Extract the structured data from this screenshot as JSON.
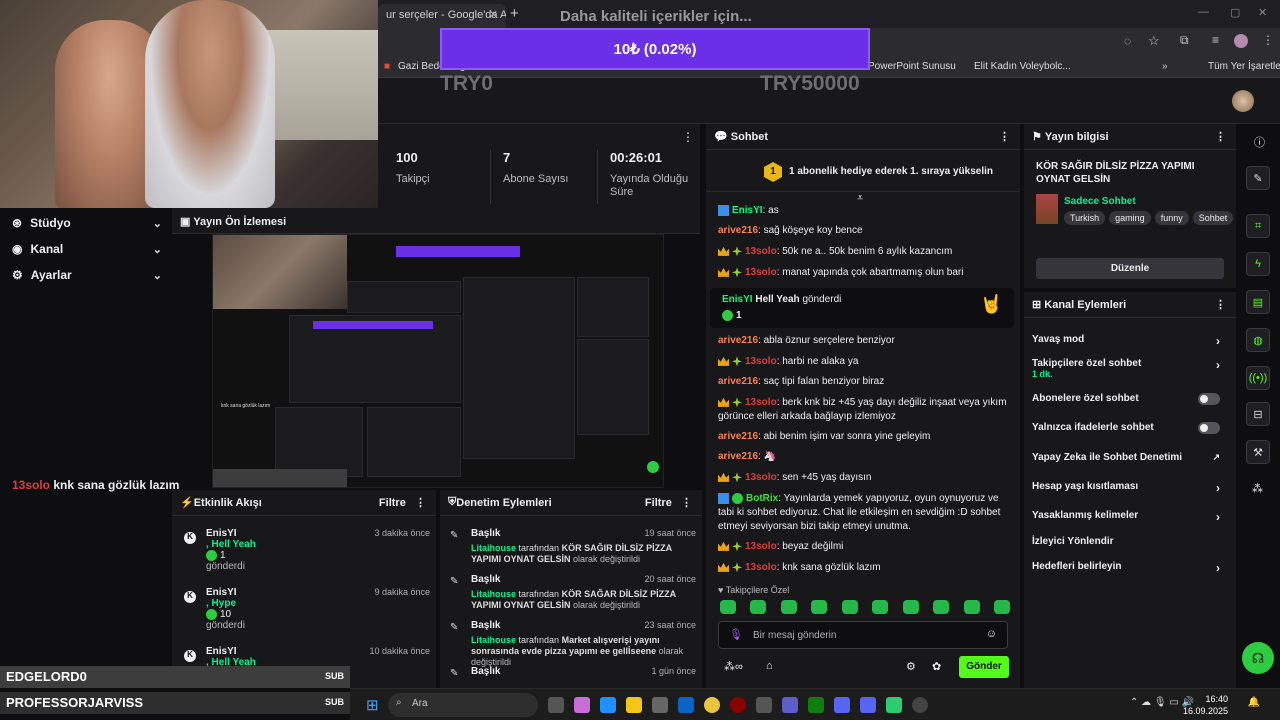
{
  "browser": {
    "tab_title": "ur serçeler - Google'da Ara",
    "bookmarks": [
      "Gazi Beden Eğitimi",
      "PowerPoint Sunusu",
      "Elit Kadın Voleybolc...",
      "Tüm Yer İşaretleri"
    ]
  },
  "donation": {
    "title": "Daha kaliteli içerikler için...",
    "progress_label": "10₺ (0.02%)",
    "progress_fraction": 0.0002,
    "min": "TRY0",
    "max": "TRY50000"
  },
  "stats": {
    "items": [
      {
        "value": "100",
        "label": "Takipçi"
      },
      {
        "value": "7",
        "label": "Abone Sayısı"
      },
      {
        "value": "00:26:01",
        "label": "Yayında Olduğu Süre"
      }
    ]
  },
  "nav": {
    "items": [
      {
        "label": "Stüdyo"
      },
      {
        "label": "Kanal"
      },
      {
        "label": "Ayarlar"
      }
    ]
  },
  "preview": {
    "title": "Yayın Ön İzlemesi",
    "overlay_user": "13solo",
    "overlay_msg": "knk sana gözlük lazım"
  },
  "activity": {
    "title": "Etkinlik Akışı",
    "filter": "Filtre",
    "items": [
      {
        "name": "EnisYI",
        "action": ", Hell Yeah",
        "count": "1",
        "sent": "gönderdi",
        "time": "3 dakika önce"
      },
      {
        "name": "EnisYI",
        "action": ", Hype",
        "count": "10",
        "sent": "gönderdi",
        "time": "9 dakika önce"
      },
      {
        "name": "EnisYI",
        "action": ", Hell Yeah",
        "count": "",
        "sent": "",
        "time": "10 dakika önce"
      }
    ]
  },
  "moderation": {
    "title": "Denetim Eylemleri",
    "filter": "Filtre",
    "items": [
      {
        "title": "Başlık",
        "time": "19 saat önce",
        "user": "Litaihouse",
        "by": "tarafından",
        "value": "KÖR SAĞIR DİLSİZ PİZZA YAPIMI OYNAT GELSİN",
        "suffix": "olarak değiştirildi"
      },
      {
        "title": "Başlık",
        "time": "20 saat önce",
        "user": "Litaihouse",
        "by": "tarafından",
        "value": "KÖR SAĞAR DİLSİZ PİZZA YAPIMI OYNAT GELSİN",
        "suffix": "olarak değiştirildi"
      },
      {
        "title": "Başlık",
        "time": "23 saat önce",
        "user": "Litaihouse",
        "by": "tarafından",
        "value": "Market alışverişi yayını sonrasında evde pizza yapımı ee gellİseene",
        "suffix": "olarak değiştirildi"
      },
      {
        "title": "Başlık",
        "time": "1 gün önce",
        "user": "",
        "by": "",
        "value": "",
        "suffix": ""
      }
    ]
  },
  "chat": {
    "title": "Sohbet",
    "pinned": "1 abonelik hediye ederek 1. sıraya yükselin",
    "pinned_count": "1",
    "messages": [
      {
        "user": "EnisYI",
        "text": "as"
      },
      {
        "user": "arive216",
        "text": "sağ köşeye koy bence"
      },
      {
        "user": "13solo",
        "text": "50k ne a.. 50k benim 6 aylık kazancım"
      },
      {
        "user": "13solo",
        "text": "manat yapında çok abartmamış olun bari"
      },
      {
        "user": "arive216",
        "text": "abla öznur serçelere benziyor"
      },
      {
        "user": "13solo",
        "text": "harbi ne alaka ya"
      },
      {
        "user": "arive216",
        "text": "saç tipi falan benziyor biraz"
      },
      {
        "user": "13solo",
        "text": "berk knk biz +45 yaş dayı değiliz inşaat veya yıkım görünce elleri arkada bağlayıp izlemiyoz"
      },
      {
        "user": "arive216",
        "text": "abi benim işim var sonra yine geleyim"
      },
      {
        "user": "arive216",
        "text": ""
      },
      {
        "user": "13solo",
        "text": "sen +45 yaş dayısın"
      },
      {
        "user": "BotRix",
        "text": "Yayınlarda yemek yapıyoruz, oyun oynuyoruz ve tabi ki sohbet ediyoruz. Chat ile etkileşim en sevdiğim :D sohbet etmeyi seviyorsan bizi takip etmeyi unutma."
      },
      {
        "user": "13solo",
        "text": "beyaz değilmi"
      },
      {
        "user": "13solo",
        "text": "knk sana gözlük lazım"
      }
    ],
    "gift": {
      "user": "EnisYI",
      "item": "Hell Yeah",
      "verb": "gönderdi",
      "count": "1"
    },
    "followers_only": "Takipçilere Özel",
    "input_placeholder": "Bir mesaj gönderin",
    "send": "Gönder"
  },
  "stream_info": {
    "title": "Yayın bilgisi",
    "stream_title": "KÖR SAĞIR DİLSİZ PİZZA YAPIMI OYNAT GELSİN",
    "category": "Sadece Sohbet",
    "tags": [
      "Turkish",
      "gaming",
      "funny",
      "Sohbet"
    ],
    "edit": "Düzenle"
  },
  "channel_actions": {
    "title": "Kanal Eylemleri",
    "items": [
      {
        "label": "Yavaş mod",
        "control": "chevron"
      },
      {
        "label": "Takipçilere özel sohbet",
        "sub": "1 dk.",
        "control": "chevron"
      },
      {
        "label": "Abonelere özel sohbet",
        "control": "toggle"
      },
      {
        "label": "Yalnızca ifadelerle sohbet",
        "control": "toggle"
      },
      {
        "label": "Yapay Zeka ile Sohbet Denetimi",
        "control": "external"
      },
      {
        "label": "Hesap yaşı kısıtlaması",
        "control": "chevron"
      },
      {
        "label": "Yasaklanmış kelimeler",
        "control": "chevron"
      },
      {
        "label": "İzleyici Yönlendir",
        "control": "none"
      },
      {
        "label": "Hedefleri belirleyin",
        "control": "chevron"
      }
    ]
  },
  "overlay_names": [
    {
      "name": "EDGELORD0",
      "badge": "SUB"
    },
    {
      "name": "PROFESSORJARVISS",
      "badge": "SUB"
    }
  ],
  "taskbar": {
    "search": "Ara",
    "time": "16:40",
    "date": "16.09.2025"
  },
  "colors": {
    "accent": "#6b2fe8",
    "kick_green": "#53fc18"
  }
}
